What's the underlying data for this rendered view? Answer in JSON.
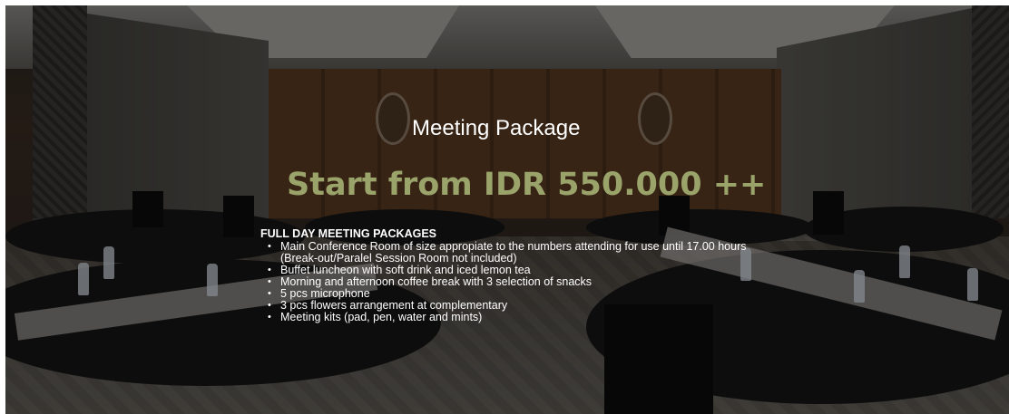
{
  "hero": {
    "title": "Meeting Package",
    "price": "Start from IDR 550.000 ++",
    "package": {
      "heading": "FULL DAY MEETING PACKAGES",
      "items": [
        "Main Conference Room of size appropiate to the numbers attending for use until 17.00 hours (Break-out/Paralel Session Room not included)",
        "Buffet luncheon with soft drink and iced lemon tea",
        "Morning and afternoon coffee break with 3 selection of snacks",
        "5 pcs microphone",
        "3 pcs flowers arrangement at complementary",
        "Meeting kits (pad, pen, water and mints)"
      ]
    },
    "bullet": "•"
  },
  "colors": {
    "price_accent": "#9aa36a",
    "text": "#ffffff",
    "overlay": "rgba(0,0,0,0.38)"
  },
  "icons": {
    "emblem": "wall-emblem-icon"
  }
}
